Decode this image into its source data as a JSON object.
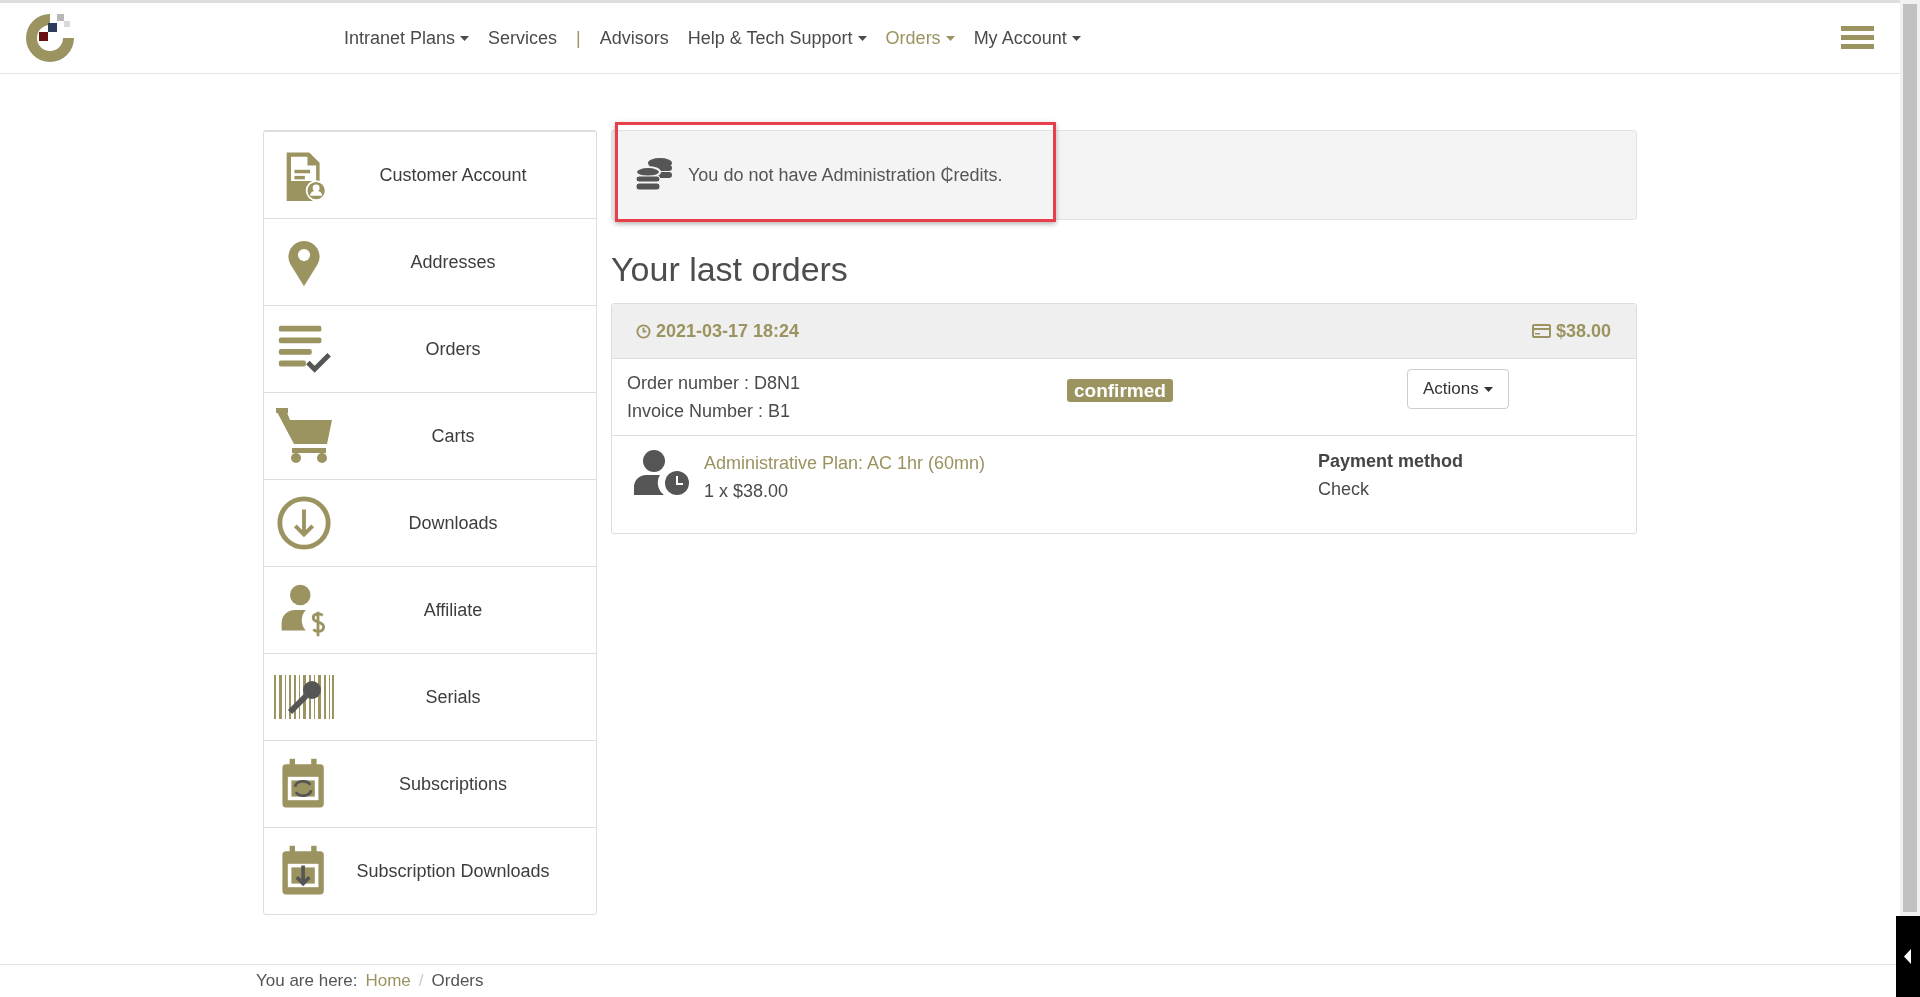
{
  "nav": {
    "items": [
      {
        "kind": "link",
        "label": "Intranet Plans",
        "caret": true,
        "selected": false
      },
      {
        "kind": "link",
        "label": "Services",
        "caret": false,
        "selected": false
      },
      {
        "kind": "separator",
        "label": "|"
      },
      {
        "kind": "link",
        "label": "Advisors",
        "caret": false,
        "selected": false
      },
      {
        "kind": "link",
        "label": "Help & Tech Support",
        "caret": true,
        "selected": false
      },
      {
        "kind": "link",
        "label": "Orders",
        "caret": true,
        "selected": true
      },
      {
        "kind": "link",
        "label": "My Account",
        "caret": true,
        "selected": false
      }
    ]
  },
  "sidebar": {
    "items": [
      {
        "label": "Customer Account"
      },
      {
        "label": "Addresses"
      },
      {
        "label": "Orders"
      },
      {
        "label": "Carts"
      },
      {
        "label": "Downloads"
      },
      {
        "label": "Affiliate"
      },
      {
        "label": "Serials"
      },
      {
        "label": "Subscriptions"
      },
      {
        "label": "Subscription Downloads"
      }
    ]
  },
  "notice": {
    "text": "You do not have Administration ₵redits.",
    "highlighted": true
  },
  "heading": "Your last orders",
  "order": {
    "date": "2021-03-17 18:24",
    "total": "$38.00",
    "order_number": "Order number : D8N1",
    "invoice_number": "Invoice Number : B1",
    "status": "confirmed",
    "actions": "Actions",
    "item": {
      "name": "Administrative Plan: AC 1hr (60mn)",
      "quantity_price": "1 x $38.00"
    },
    "payment_label": "Payment method",
    "payment_value": "Check"
  },
  "breadcrumb": {
    "label": "You are here:",
    "links": [
      {
        "label": "Home",
        "current": false
      },
      {
        "label": "Orders",
        "current": true
      }
    ],
    "separator": "/"
  }
}
